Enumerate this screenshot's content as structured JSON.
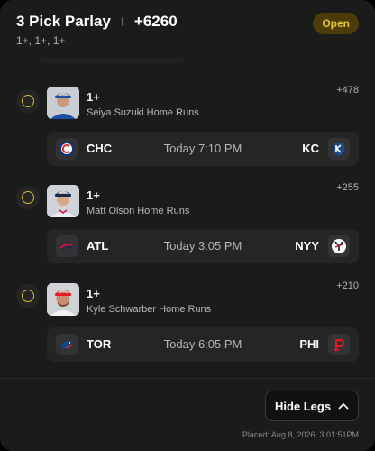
{
  "header": {
    "title": "3 Pick Parlay",
    "odds": "+6260",
    "subtitle": "1+, 1+, 1+",
    "status_badge": "Open",
    "status_color": "#e4c430"
  },
  "legs": [
    {
      "line": "1+",
      "description": "Seiya Suzuki Home Runs",
      "odds": "+478",
      "away": {
        "code": "CHC",
        "logo": "cubs-logo-icon"
      },
      "time": "Today 7:10 PM",
      "home": {
        "code": "KC",
        "logo": "royals-logo-icon"
      }
    },
    {
      "line": "1+",
      "description": "Matt Olson Home Runs",
      "odds": "+255",
      "away": {
        "code": "ATL",
        "logo": "braves-logo-icon"
      },
      "time": "Today 3:05 PM",
      "home": {
        "code": "NYY",
        "logo": "yankees-logo-icon"
      }
    },
    {
      "line": "1+",
      "description": "Kyle Schwarber Home Runs",
      "odds": "+210",
      "away": {
        "code": "TOR",
        "logo": "blue-jays-logo-icon"
      },
      "time": "Today 6:05 PM",
      "home": {
        "code": "PHI",
        "logo": "phillies-logo-icon"
      }
    }
  ],
  "footer": {
    "hide_label": "Hide Legs",
    "placed": "Placed: Aug 8, 2026, 3:01:51PM"
  }
}
